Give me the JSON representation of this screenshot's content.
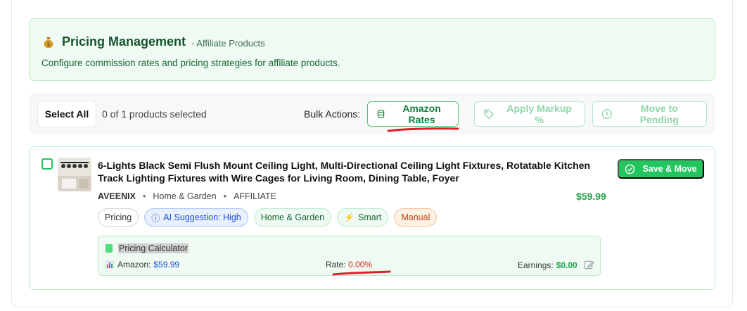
{
  "header": {
    "title": "Pricing Management",
    "subtitle": "- Affiliate Products",
    "description": "Configure commission rates and pricing strategies for affiliate products."
  },
  "bulk_bar": {
    "select_all_label": "Select All",
    "selection_count": "0 of 1 products selected",
    "bulk_actions_label": "Bulk Actions:",
    "amazon_rates_label": "Amazon Rates",
    "apply_markup_label": "Apply Markup %",
    "move_pending_label": "Move to Pending"
  },
  "product": {
    "title": "6-Lights Black Semi Flush Mount Ceiling Light, Multi-Directional Ceiling Light Fixtures, Rotatable Kitchen Track Lighting Fixtures with Wire Cages for Living Room, Dining Table, Foyer",
    "brand": "AVEENIX",
    "category": "Home & Garden",
    "type": "AFFILIATE",
    "price": "$59.99",
    "save_label": "Save & Move",
    "tags": {
      "pricing": "Pricing",
      "ai": "AI Suggestion: High",
      "category": "Home & Garden",
      "smart": "Smart",
      "manual": "Manual"
    },
    "calculator": {
      "title": "Pricing Calculator",
      "amazon_label": "Amazon:",
      "amazon_value": "$59.99",
      "rate_label": "Rate:",
      "rate_value": "0.00%",
      "earnings_label": "Earnings:",
      "earnings_value": "$0.00"
    }
  },
  "colors": {
    "accent_green": "#22c55e",
    "annotation_red": "#e11d2a"
  }
}
